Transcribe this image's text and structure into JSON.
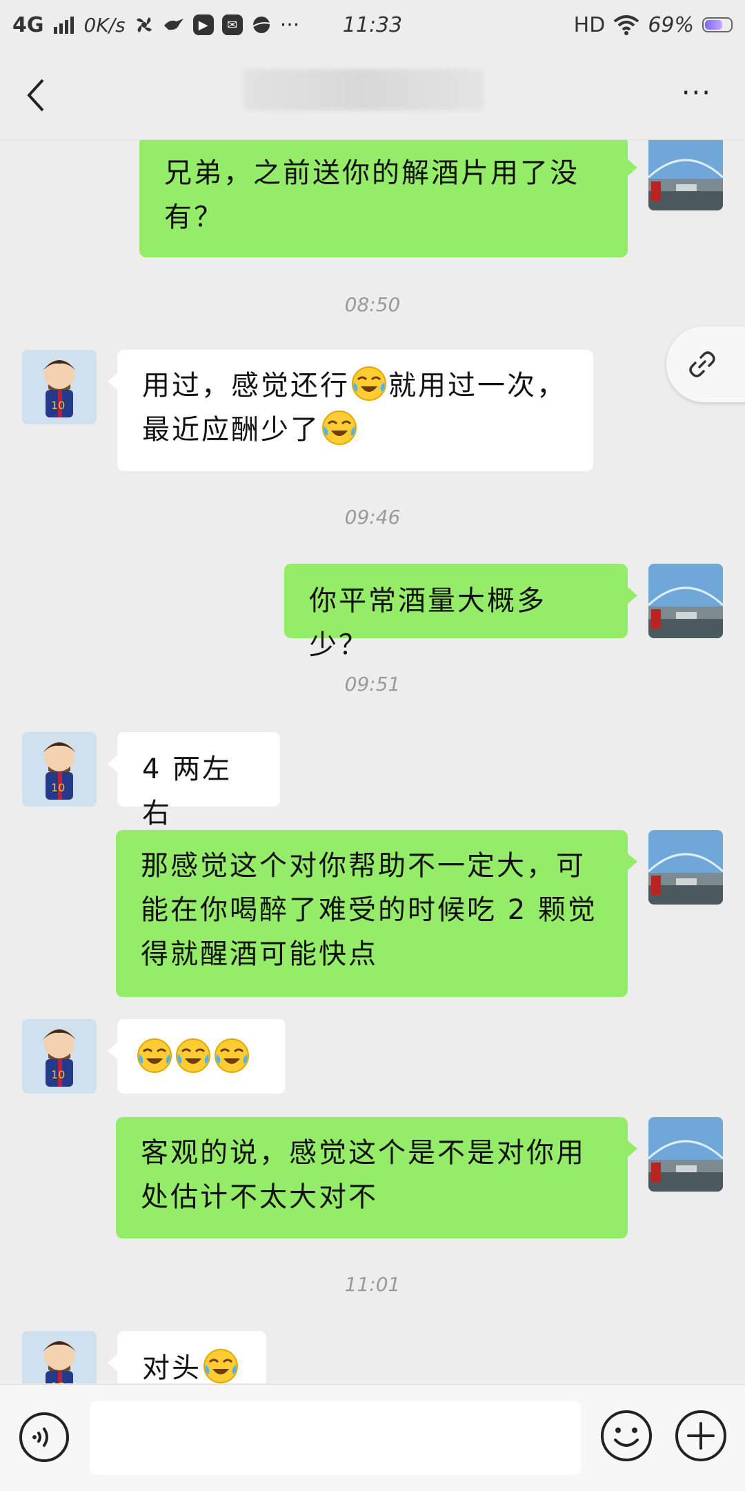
{
  "status_bar": {
    "network": "4G",
    "speed": "0K/s",
    "dots": "···",
    "time": "11:33",
    "hd": "HD",
    "battery": "69%",
    "battery_level": 0.69
  },
  "nav": {
    "title": "",
    "more": "···"
  },
  "messages": [
    {
      "side": "me",
      "text": "兄弟，之前送你的解酒片用了没有？"
    },
    {
      "type": "time",
      "text": "08:50"
    },
    {
      "side": "them",
      "line1a": "用过，感觉还行",
      "line1b": "就用过一次，",
      "line2": "最近应酬少了"
    },
    {
      "type": "time",
      "text": "09:46"
    },
    {
      "side": "me",
      "text": "你平常酒量大概多少？"
    },
    {
      "type": "time",
      "text": "09:51"
    },
    {
      "side": "them",
      "text": "4 两左右"
    },
    {
      "side": "me",
      "text": "那感觉这个对你帮助不一定大，可能在你喝醉了难受的时候吃 2 颗觉得就醒酒可能快点"
    },
    {
      "side": "them",
      "emoji_only": true,
      "emoji": "crying-laughing"
    },
    {
      "side": "me",
      "text": "客观的说，感觉这个是不是对你用处估计不太大对不"
    },
    {
      "type": "time",
      "text": "11:01"
    },
    {
      "side": "them",
      "text": "对头"
    }
  ],
  "input": {
    "value": "",
    "placeholder": ""
  },
  "colors": {
    "background": "#ededed",
    "my_bubble": "#95ec69",
    "their_bubble": "#ffffff",
    "timestamp": "#9a9a9a"
  }
}
